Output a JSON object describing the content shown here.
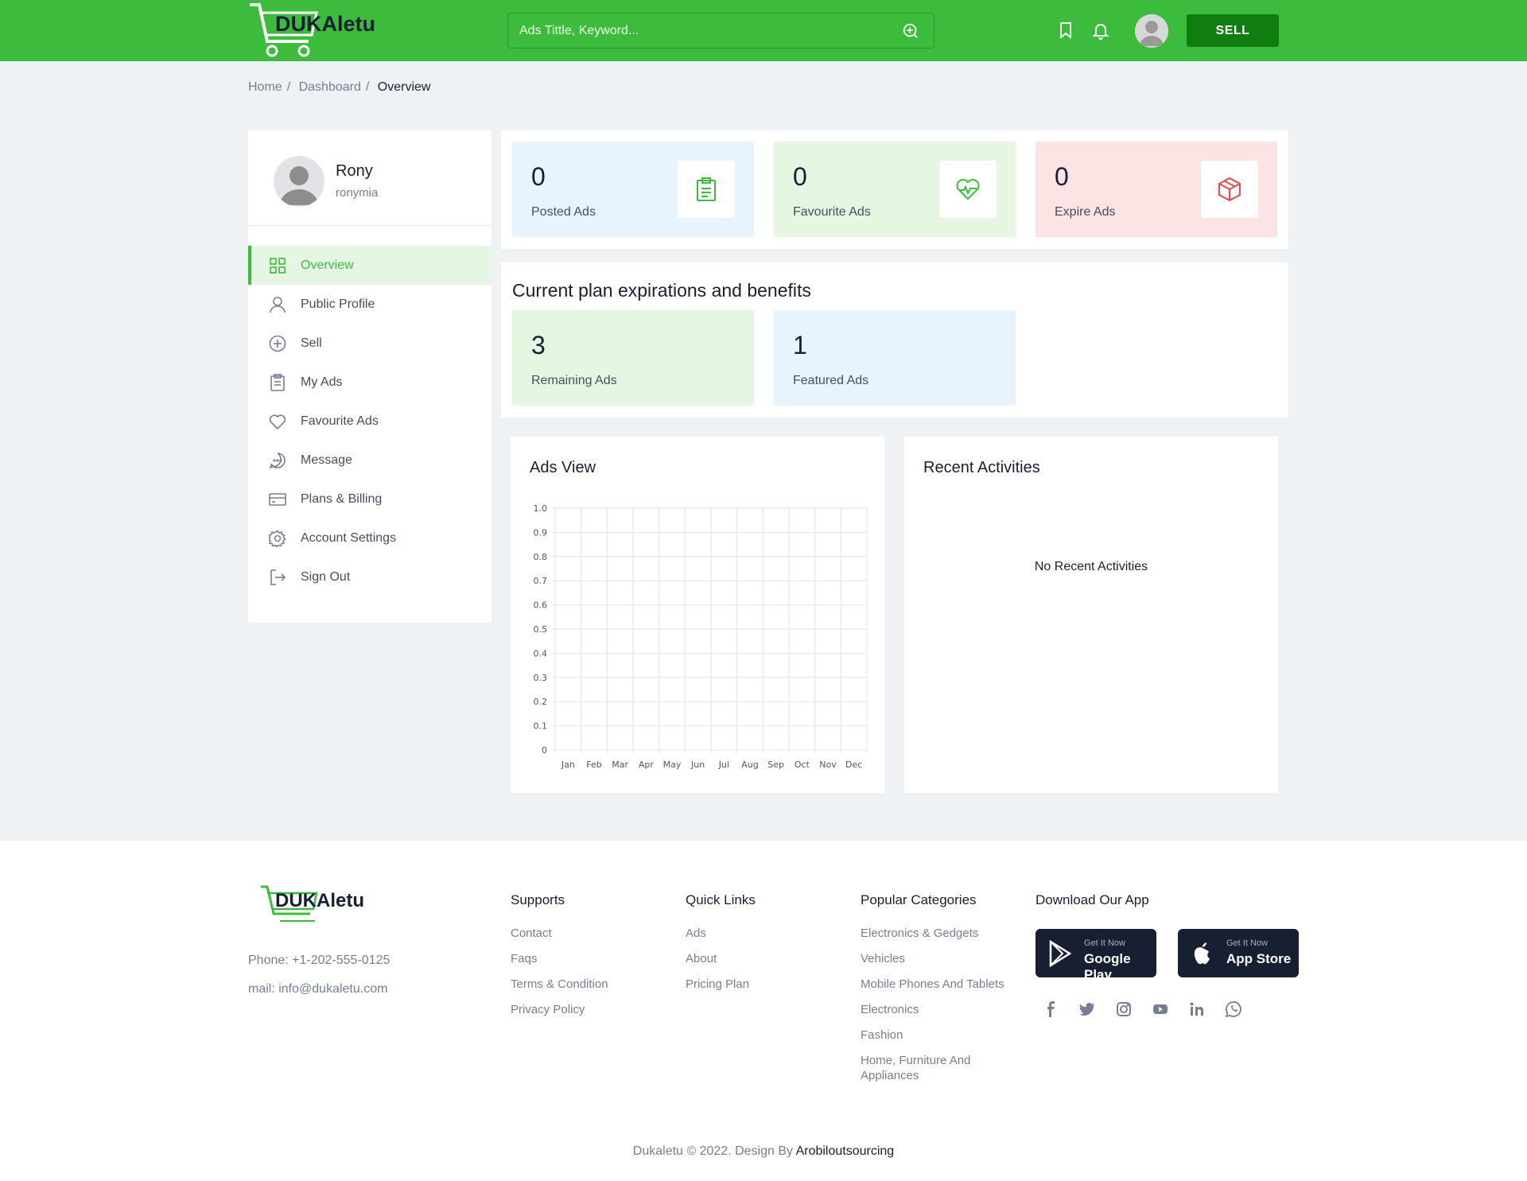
{
  "header": {
    "brand": "DUKAletu",
    "search_placeholder": "Ads Tittle, Keyword...",
    "sell_label": "SELL",
    "colors": {
      "primary": "#3dbb3d",
      "sell_button": "#0f7d0f"
    }
  },
  "breadcrumb": [
    "Home",
    "Dashboard",
    "Overview"
  ],
  "profile": {
    "name": "Rony",
    "username": "ronymia"
  },
  "sidebar": {
    "items": [
      {
        "label": "Overview",
        "icon": "grid-icon",
        "active": true
      },
      {
        "label": "Public Profile",
        "icon": "user-icon"
      },
      {
        "label": "Sell",
        "icon": "plus-circle-icon"
      },
      {
        "label": "My Ads",
        "icon": "clipboard-icon"
      },
      {
        "label": "Favourite Ads",
        "icon": "heart-icon"
      },
      {
        "label": "Message",
        "icon": "chat-icon"
      },
      {
        "label": "Plans & Billing",
        "icon": "credit-card-icon"
      },
      {
        "label": "Account Settings",
        "icon": "gear-icon"
      },
      {
        "label": "Sign Out",
        "icon": "sign-out-icon"
      }
    ]
  },
  "stats": [
    {
      "value": "0",
      "label": "Posted Ads",
      "icon": "clipboard-icon"
    },
    {
      "value": "0",
      "label": "Favourite Ads",
      "icon": "heart-pulse-icon"
    },
    {
      "value": "0",
      "label": "Expire Ads",
      "icon": "box-icon"
    }
  ],
  "plan": {
    "title": "Current plan expirations and benefits",
    "items": [
      {
        "value": "3",
        "label": "Remaining Ads"
      },
      {
        "value": "1",
        "label": "Featured Ads"
      }
    ]
  },
  "ads_view": {
    "title": "Ads View"
  },
  "chart_data": {
    "type": "line",
    "categories": [
      "Jan",
      "Feb",
      "Mar",
      "Apr",
      "May",
      "Jun",
      "Jul",
      "Aug",
      "Sep",
      "Oct",
      "Nov",
      "Dec"
    ],
    "series": [],
    "ylim": [
      0,
      1
    ],
    "yticks": [
      "0",
      "0.1",
      "0.2",
      "0.3",
      "0.4",
      "0.5",
      "0.6",
      "0.7",
      "0.8",
      "0.9",
      "1.0"
    ],
    "grid": true
  },
  "recent": {
    "title": "Recent Activities",
    "empty_text": "No Recent Activities"
  },
  "footer": {
    "brand": "DUKAletu",
    "phone": "Phone: +1-202-555-0125",
    "mail": "mail: info@dukaletu.com",
    "supports": {
      "title": "Supports",
      "links": [
        "Contact",
        "Faqs",
        "Terms & Condition",
        "Privacy Policy"
      ]
    },
    "quick_links": {
      "title": "Quick Links",
      "links": [
        "Ads",
        "About",
        "Pricing Plan"
      ]
    },
    "categories": {
      "title": "Popular Categories",
      "links": [
        "Electronics & Gedgets",
        "Vehicles",
        "Mobile Phones And Tablets",
        "Electronics",
        "Fashion",
        "Home, Furniture And Appliances"
      ]
    },
    "app": {
      "title": "Download Our App",
      "google": {
        "small": "Get It Now",
        "big": "Google Play"
      },
      "apple": {
        "small": "Get It Now",
        "big": "App Store"
      }
    },
    "social": [
      "facebook-icon",
      "twitter-icon",
      "instagram-icon",
      "youtube-icon",
      "linkedin-icon",
      "whatsapp-icon"
    ],
    "copyright": "Dukaletu © 2022. Design By",
    "designer": "Arobiloutsourcing"
  }
}
